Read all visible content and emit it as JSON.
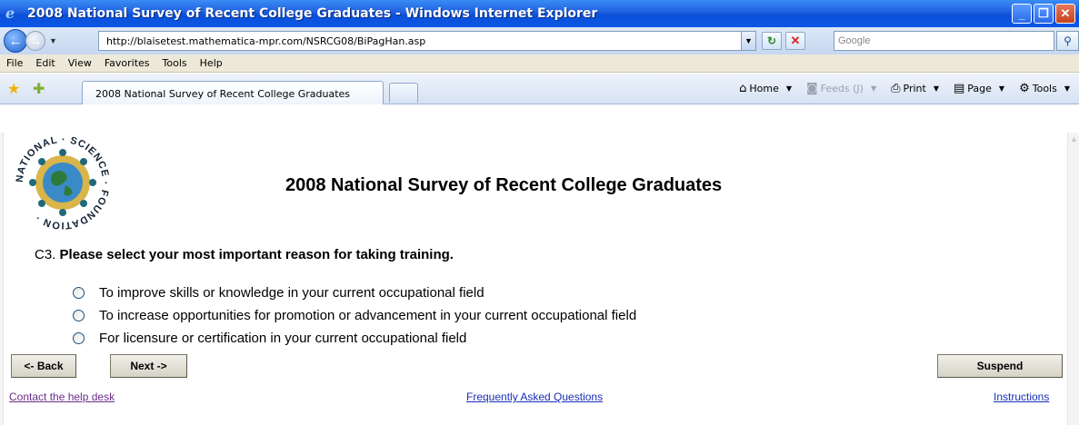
{
  "window": {
    "title": "2008 National Survey of Recent College Graduates - Windows Internet Explorer"
  },
  "addressbar": {
    "url": "http://blaisetest.mathematica-mpr.com/NSRCG08/BiPagHan.asp",
    "search_placeholder": "Google"
  },
  "menu": [
    "File",
    "Edit",
    "View",
    "Favorites",
    "Tools",
    "Help"
  ],
  "tab": {
    "label": "2008 National Survey of Recent College Graduates"
  },
  "commands": {
    "home": "Home",
    "feeds": "Feeds (J)",
    "print": "Print",
    "page": "Page",
    "tools": "Tools"
  },
  "page": {
    "logo_text": "NATIONAL SCIENCE FOUNDATION",
    "title": "2008 National Survey of Recent College Graduates",
    "question_number": "C3.",
    "question_text": "Please select your most important reason for taking training.",
    "options": [
      "To improve skills or knowledge in your current occupational field",
      "To increase opportunities for promotion or advancement in your current occupational field",
      "For licensure or certification in your current occupational field"
    ],
    "buttons": {
      "back": "<- Back",
      "next": "Next ->",
      "suspend": "Suspend"
    },
    "links": {
      "help": "Contact the help desk",
      "faq": "Frequently Asked Questions",
      "instructions": "Instructions"
    }
  },
  "colors": {
    "titlebar": "#0a4fd8",
    "link": "#1a2fb8",
    "visited_link": "#6b2c8a"
  }
}
